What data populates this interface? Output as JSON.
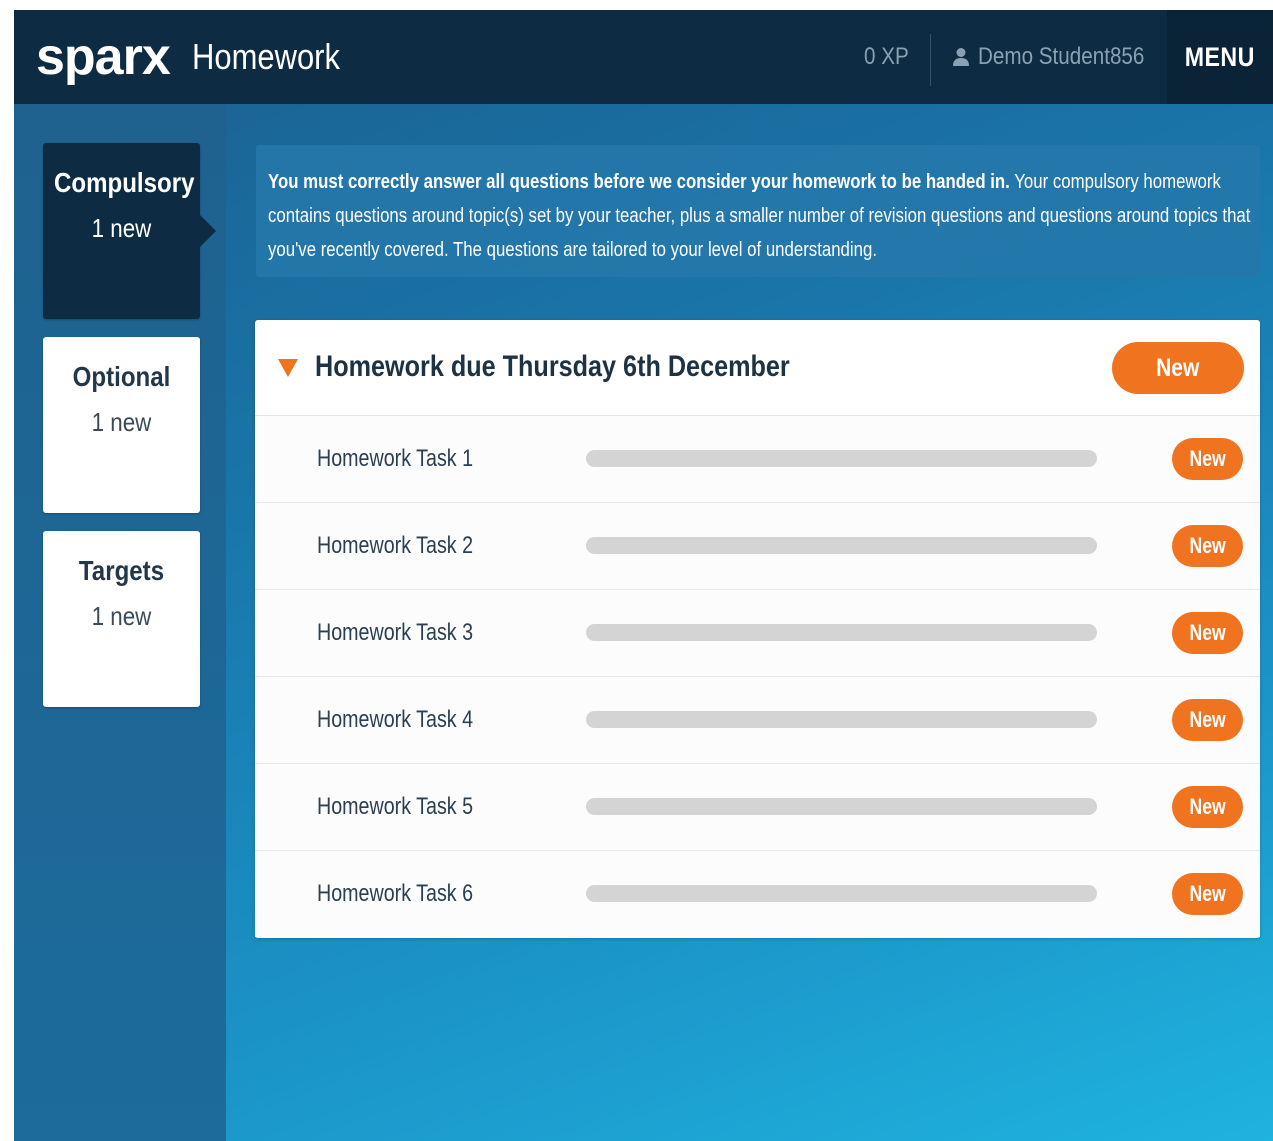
{
  "header": {
    "logo": "sparx",
    "title": "Homework",
    "xp": "0 XP",
    "user_name": "Demo Student856",
    "menu_label": "MENU"
  },
  "sidebar": {
    "tabs": [
      {
        "label": "Compulsory",
        "sub": "1 new",
        "active": true
      },
      {
        "label": "Optional",
        "sub": "1 new",
        "active": false
      },
      {
        "label": "Targets",
        "sub": "1 new",
        "active": false
      }
    ]
  },
  "info": {
    "bold": "You must correctly answer all questions before we consider your homework to be handed in.",
    "text": " Your compulsory homework contains questions around topic(s) set by your teacher, plus a smaller number of revision questions and questions around topics that you've recently covered. The questions are tailored to your level of understanding."
  },
  "homework": {
    "title": "Homework due Thursday 6th December",
    "badge": "New",
    "tasks": [
      {
        "label": "Homework Task 1",
        "badge": "New",
        "progress": 0
      },
      {
        "label": "Homework Task 2",
        "badge": "New",
        "progress": 0
      },
      {
        "label": "Homework Task 3",
        "badge": "New",
        "progress": 0
      },
      {
        "label": "Homework Task 4",
        "badge": "New",
        "progress": 0
      },
      {
        "label": "Homework Task 5",
        "badge": "New",
        "progress": 0
      },
      {
        "label": "Homework Task 6",
        "badge": "New",
        "progress": 0
      }
    ]
  },
  "colors": {
    "header_bg": "#0d2c43",
    "accent_orange": "#f07320",
    "progress_track": "#d4d4d4"
  },
  "icons": {
    "user": "user-icon",
    "collapse": "caret-down-icon"
  }
}
